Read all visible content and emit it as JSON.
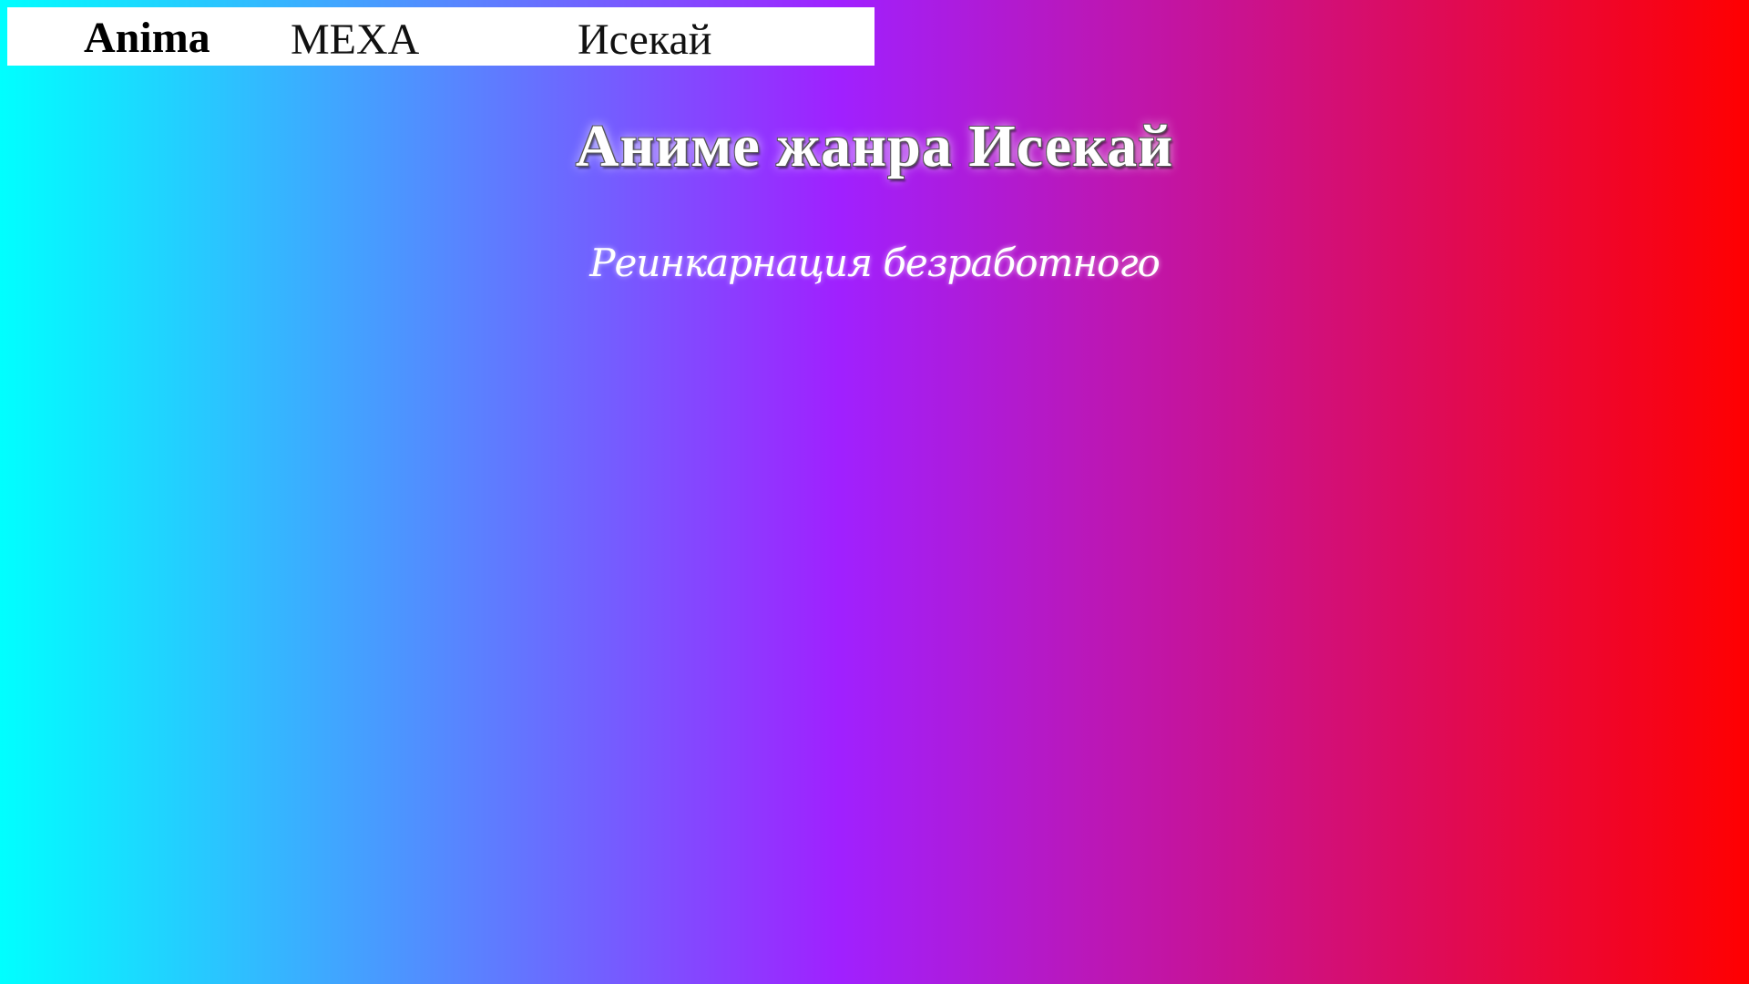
{
  "header": {
    "brand": "Anima",
    "nav": [
      {
        "label": "МЕХА"
      },
      {
        "label": "Исекай"
      }
    ]
  },
  "main": {
    "title": "Аниме жанра Исекай",
    "items": [
      {
        "label": "Реинкарнация безработного"
      }
    ]
  },
  "colors": {
    "gradient_start": "#00ffff",
    "gradient_mid": "#a020ff",
    "gradient_end": "#ff0000",
    "topbar_background": "#ffffff",
    "title_color": "#ffffff"
  }
}
